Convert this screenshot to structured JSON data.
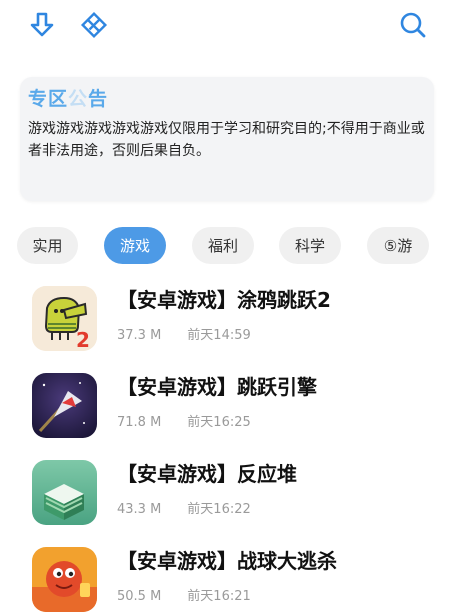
{
  "toolbar": {
    "download_icon": "arrow-down-icon",
    "diamond_icon": "diamond-icon",
    "search_icon": "search-icon",
    "accent": "#2f86e0"
  },
  "notice": {
    "title_visible": "专区",
    "title_faded": "公",
    "title_end": "告",
    "body": "游戏游戏游戏游戏游戏仅限用于学习和研究目的;不得用于商业或者非法用途，否则后果自负。"
  },
  "tabs": [
    {
      "label": "实用",
      "active": false
    },
    {
      "label": "游戏",
      "active": true
    },
    {
      "label": "福利",
      "active": false
    },
    {
      "label": "科学",
      "active": false
    },
    {
      "label": "⑤游",
      "active": false
    }
  ],
  "apps": [
    {
      "title": "【安卓游戏】涂鸦跳跃2",
      "size": "37.3 M",
      "time": "前天14:59",
      "icon": "doodle-jump-icon",
      "badge": "2"
    },
    {
      "title": "【安卓游戏】跳跃引擎",
      "size": "71.8 M",
      "time": "前天16:25",
      "icon": "jump-engine-icon"
    },
    {
      "title": "【安卓游戏】反应堆",
      "size": "43.3 M",
      "time": "前天16:22",
      "icon": "stack-icon"
    },
    {
      "title": "【安卓游戏】战球大逃杀",
      "size": "50.5 M",
      "time": "前天16:21",
      "icon": "battle-ball-icon"
    }
  ]
}
